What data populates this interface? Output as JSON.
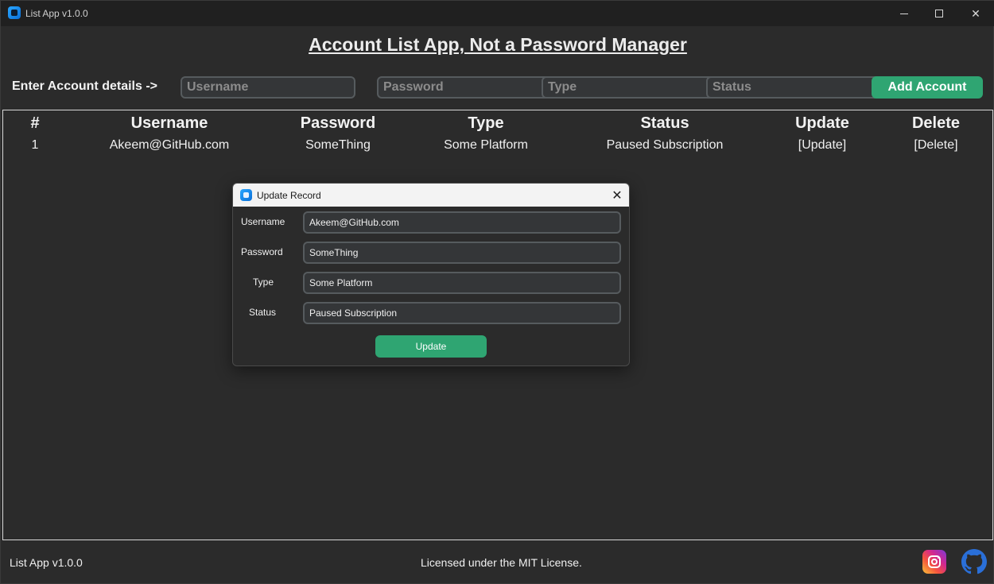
{
  "window": {
    "title": "List App v1.0.0"
  },
  "heading": "Account List App, Not a Password Manager",
  "entry": {
    "label": "Enter Account details ->",
    "username_placeholder": "Username",
    "password_placeholder": "Password",
    "type_placeholder": "Type",
    "status_placeholder": "Status",
    "add_button": "Add Account"
  },
  "table": {
    "headers": [
      "#",
      "Username",
      "Password",
      "Type",
      "Status",
      "Update",
      "Delete"
    ],
    "rows": [
      [
        "1",
        "Akeem@GitHub.com",
        "SomeThing",
        "Some Platform",
        "Paused Subscription",
        "[Update]",
        "[Delete]"
      ]
    ]
  },
  "dialog": {
    "title": "Update Record",
    "labels": {
      "username": "Username",
      "password": "Password",
      "type": "Type",
      "status": "Status"
    },
    "values": {
      "username": "Akeem@GitHub.com",
      "password": "SomeThing",
      "type": "Some Platform",
      "status": "Paused Subscription"
    },
    "button": "Update"
  },
  "footer": {
    "version": "List App v1.0.0",
    "license": "Licensed under the MIT License.",
    "icons": [
      "instagram-icon",
      "github-icon"
    ]
  },
  "colors": {
    "accent": "#2fa572",
    "background": "#2b2b2b",
    "field": "#343638"
  }
}
